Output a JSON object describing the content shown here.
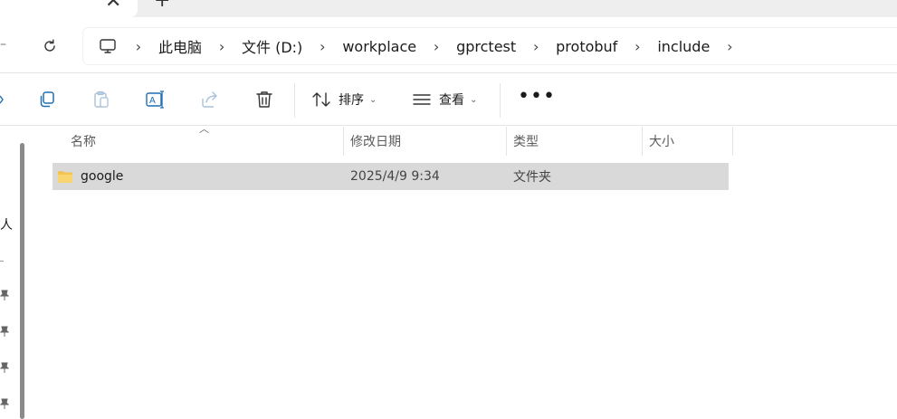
{
  "window": {
    "tab_close_glyph": "✕",
    "tab_new_glyph": "+"
  },
  "address": {
    "crumbs": [
      "此电脑",
      "文件 (D:)",
      "workplace",
      "gprctest",
      "protobuf",
      "include"
    ],
    "separator": "›"
  },
  "toolbar": {
    "sort_label": "排序",
    "view_label": "查看",
    "caret": "⌄",
    "more": "•••"
  },
  "leftnav": {
    "partial_text": "人"
  },
  "columns": {
    "name": "名称",
    "modified": "修改日期",
    "type": "类型",
    "size": "大小"
  },
  "files": [
    {
      "name": "google",
      "modified": "2025/4/9 9:34",
      "type": "文件夹",
      "size": ""
    }
  ],
  "colors": {
    "selected_row": "#d9d9d9",
    "folder": "#f3c24f",
    "accent_icon": "#1f6fb5"
  }
}
